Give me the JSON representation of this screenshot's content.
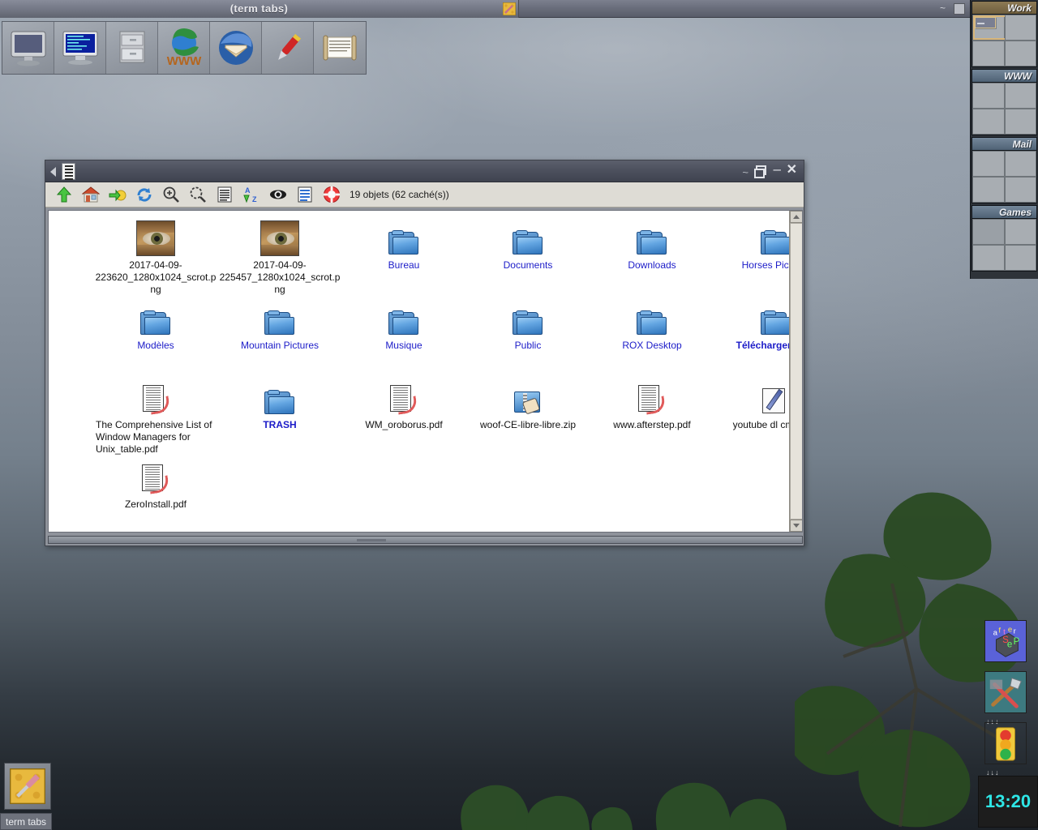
{
  "topbar": {
    "title": "(term tabs)",
    "title_icon": "screwdriver-icon",
    "shade_glyph": "~",
    "launchers": [
      {
        "name": "computer-monitor-icon",
        "label": "Computer"
      },
      {
        "name": "terminal-monitor-icon",
        "label": "Terminal"
      },
      {
        "name": "file-cabinet-icon",
        "label": "File manager"
      },
      {
        "name": "www-globe-icon",
        "label": "Web browser"
      },
      {
        "name": "thunderbird-mail-icon",
        "label": "Mail"
      },
      {
        "name": "red-pen-icon",
        "label": "Editor"
      },
      {
        "name": "scroll-document-icon",
        "label": "Documents"
      }
    ]
  },
  "pager": {
    "desks": [
      {
        "label": "Work",
        "active": true
      },
      {
        "label": "WWW",
        "active": false
      },
      {
        "label": "Mail",
        "active": false
      },
      {
        "label": "Games",
        "active": false
      }
    ]
  },
  "filemanager": {
    "titlebar": {
      "shade_label": "~",
      "maximize_label": "",
      "minimize_label": "–",
      "close_label": "✕"
    },
    "toolbar": {
      "buttons": [
        {
          "name": "up-arrow-icon",
          "label": "Monter"
        },
        {
          "name": "home-icon",
          "label": "Dossier personnel"
        },
        {
          "name": "bookmarks-icon",
          "label": "Signets"
        },
        {
          "name": "refresh-icon",
          "label": "Rafraîchir"
        },
        {
          "name": "zoom-in-icon",
          "label": "Agrandir"
        },
        {
          "name": "zoom-fit-icon",
          "label": "Taille normale"
        },
        {
          "name": "details-view-icon",
          "label": "Détails"
        },
        {
          "name": "sort-az-icon",
          "label": "Trier"
        },
        {
          "name": "show-hidden-icon",
          "label": "Fichiers cachés"
        },
        {
          "name": "list-view-icon",
          "label": "Affichage liste"
        },
        {
          "name": "help-icon",
          "label": "Aide"
        }
      ],
      "status": "19 objets (62 caché(s))"
    },
    "items": [
      {
        "label": "2017-04-09-223620_1280x1024_scrot.png",
        "type": "image",
        "bold": false
      },
      {
        "label": "2017-04-09-225457_1280x1024_scrot.png",
        "type": "image",
        "bold": false
      },
      {
        "label": "Bureau",
        "type": "folder",
        "bold": false
      },
      {
        "label": "Documents",
        "type": "folder",
        "bold": false
      },
      {
        "label": "Downloads",
        "type": "folder",
        "bold": false
      },
      {
        "label": "Horses Pictures",
        "type": "folder",
        "bold": false
      },
      {
        "label": "Modèles",
        "type": "folder",
        "bold": false
      },
      {
        "label": "Mountain Pictures",
        "type": "folder",
        "bold": false
      },
      {
        "label": "Musique",
        "type": "folder",
        "bold": false
      },
      {
        "label": "Public",
        "type": "folder",
        "bold": false
      },
      {
        "label": "ROX Desktop",
        "type": "folder",
        "bold": false
      },
      {
        "label": "Téléchargements",
        "type": "folder",
        "bold": true
      },
      {
        "label": "The Comprehensive List of Window Managers for Unix_table.pdf",
        "type": "pdf",
        "bold": false
      },
      {
        "label": "TRASH",
        "type": "folder",
        "bold": true
      },
      {
        "label": "WM_oroborus.pdf",
        "type": "pdf",
        "bold": false
      },
      {
        "label": "woof-CE-libre-libre.zip",
        "type": "zip",
        "bold": false
      },
      {
        "label": "www.afterstep.pdf",
        "type": "pdf",
        "bold": false
      },
      {
        "label": "youtube dl cmd.abw",
        "type": "abw",
        "bold": false
      },
      {
        "label": "ZeroInstall.pdf",
        "type": "pdf",
        "bold": false
      }
    ]
  },
  "dock": {
    "items": [
      {
        "name": "afterstep-logo-icon",
        "label": "AfterStep"
      },
      {
        "name": "tools-hammer-icon",
        "label": "Tools",
        "dots": "↓↓↓"
      },
      {
        "name": "traffic-light-icon",
        "label": "Monitor",
        "dots": "↓↓↓"
      }
    ],
    "clock": "13:20"
  },
  "taskbar": {
    "button_icon": "screwdriver-icon",
    "button_label": "term tabs"
  },
  "colors": {
    "folder_label": "#1b1bc8",
    "file_label": "#111111",
    "clock_text": "#2ee6e6",
    "pager_work": "#8d7a55",
    "pager_other": "#74879a"
  }
}
